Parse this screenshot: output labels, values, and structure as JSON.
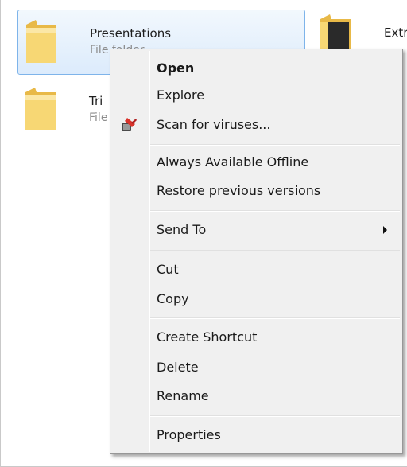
{
  "files": [
    {
      "name": "Presentations",
      "type": "File folder",
      "selected": true
    },
    {
      "name": "Tri",
      "type": "File"
    },
    {
      "name": "Extr",
      "type": ""
    }
  ],
  "context_menu": {
    "items": [
      {
        "label": "Open",
        "bold": true
      },
      {
        "label": "Explore"
      },
      {
        "label": "Scan for viruses...",
        "icon": "antivirus-scan-icon"
      },
      {
        "label": "Always Available Offline"
      },
      {
        "label": "Restore previous versions"
      },
      {
        "label": "Send To",
        "submenu": true
      },
      {
        "label": "Cut"
      },
      {
        "label": "Copy"
      },
      {
        "label": "Create Shortcut"
      },
      {
        "label": "Delete"
      },
      {
        "label": "Rename"
      },
      {
        "label": "Properties"
      }
    ]
  },
  "colors": {
    "selection_border": "#7eb4ea",
    "menu_background": "#f0f0f0",
    "folder_yellow": "#f5d26a"
  }
}
